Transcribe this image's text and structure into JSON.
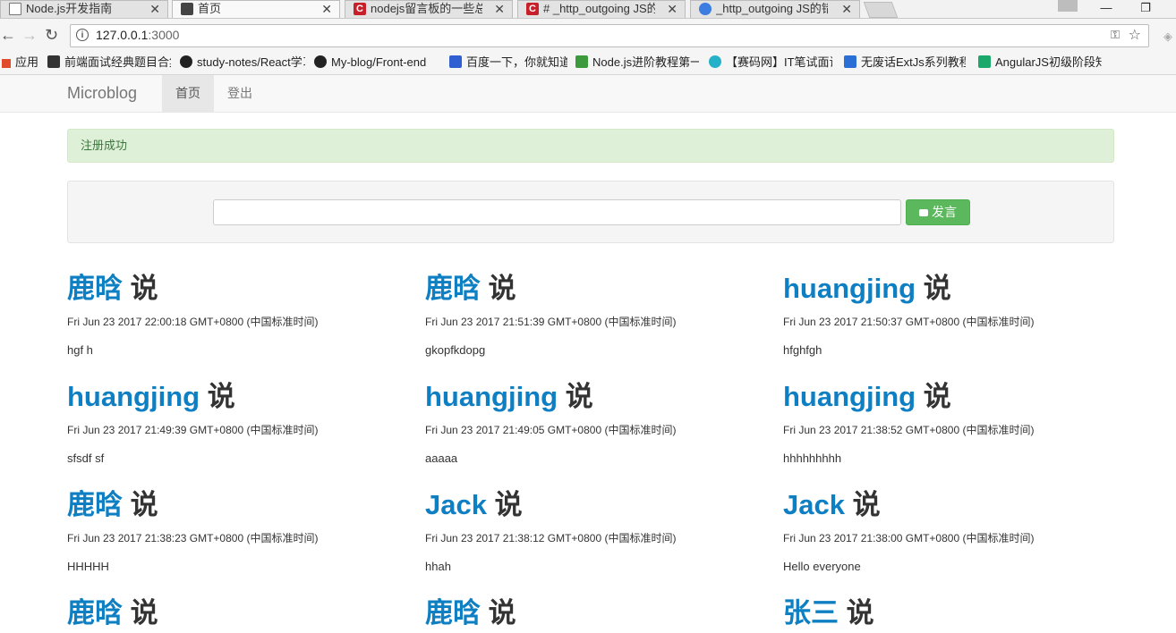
{
  "browser": {
    "tabs": [
      {
        "label": "Node.js开发指南",
        "icon": "page-icon",
        "active": false
      },
      {
        "label": "首页",
        "icon": "favicon-icon",
        "active": true
      },
      {
        "label": "nodejs留言板的一些总结",
        "icon": "csdn-icon",
        "active": false
      },
      {
        "label": "# _http_outgoing JS的错误",
        "icon": "csdn-icon",
        "active": false
      },
      {
        "label": "_http_outgoing JS的错误",
        "icon": "globe-icon",
        "active": false
      }
    ],
    "url_host": "127.0.0.1",
    "url_port": ":3000",
    "bookmarks": [
      {
        "label": "应用",
        "icon": "apps-icon",
        "color": "#e04b2c"
      },
      {
        "label": "前端面试经典题目合集",
        "icon": "bookmark-icon",
        "color": "#333333"
      },
      {
        "label": "study-notes/React学习",
        "icon": "github-icon",
        "color": "#222222"
      },
      {
        "label": "My-blog/Front-end",
        "icon": "github-icon",
        "color": "#222222"
      },
      {
        "label": "百度一下，你就知道",
        "icon": "baidu-icon",
        "color": "#2f5fd0"
      },
      {
        "label": "Node.js进阶教程第一",
        "icon": "bookmark-icon",
        "color": "#3c9a3c"
      },
      {
        "label": "【赛码网】IT笔试面试",
        "icon": "saima-icon",
        "color": "#25b2c8"
      },
      {
        "label": "无废话ExtJs系列教程",
        "icon": "bookmark-icon",
        "color": "#2a6fd6"
      },
      {
        "label": "AngularJS初级阶段知识",
        "icon": "w-icon",
        "color": "#1aa86b"
      }
    ]
  },
  "app": {
    "brand": "Microblog",
    "nav": [
      {
        "label": "首页",
        "active": true
      },
      {
        "label": "登出",
        "active": false
      }
    ],
    "alert": "注册成功",
    "post_button": "发言",
    "post_input_value": ""
  },
  "posts": [
    {
      "user": "鹿晗",
      "says": "说",
      "time": "Fri Jun 23 2017 22:00:18 GMT+0800 (中国标准时间)",
      "text": "hgf h"
    },
    {
      "user": "鹿晗",
      "says": "说",
      "time": "Fri Jun 23 2017 21:51:39 GMT+0800 (中国标准时间)",
      "text": "gkopfkdopg"
    },
    {
      "user": "huangjing",
      "says": "说",
      "time": "Fri Jun 23 2017 21:50:37 GMT+0800 (中国标准时间)",
      "text": "hfghfgh"
    },
    {
      "user": "huangjing",
      "says": "说",
      "time": "Fri Jun 23 2017 21:49:39 GMT+0800 (中国标准时间)",
      "text": "sfsdf sf"
    },
    {
      "user": "huangjing",
      "says": "说",
      "time": "Fri Jun 23 2017 21:49:05 GMT+0800 (中国标准时间)",
      "text": "aaaaa"
    },
    {
      "user": "huangjing",
      "says": "说",
      "time": "Fri Jun 23 2017 21:38:52 GMT+0800 (中国标准时间)",
      "text": "hhhhhhhhh"
    },
    {
      "user": "鹿晗",
      "says": "说",
      "time": "Fri Jun 23 2017 21:38:23 GMT+0800 (中国标准时间)",
      "text": "HHHHH"
    },
    {
      "user": "Jack",
      "says": "说",
      "time": "Fri Jun 23 2017 21:38:12 GMT+0800 (中国标准时间)",
      "text": "hhah"
    },
    {
      "user": "Jack",
      "says": "说",
      "time": "Fri Jun 23 2017 21:38:00 GMT+0800 (中国标准时间)",
      "text": "Hello everyone"
    },
    {
      "user": "鹿晗",
      "says": "说",
      "time": "",
      "text": ""
    },
    {
      "user": "鹿晗",
      "says": "说",
      "time": "",
      "text": ""
    },
    {
      "user": "张三",
      "says": "说",
      "time": "",
      "text": ""
    }
  ]
}
